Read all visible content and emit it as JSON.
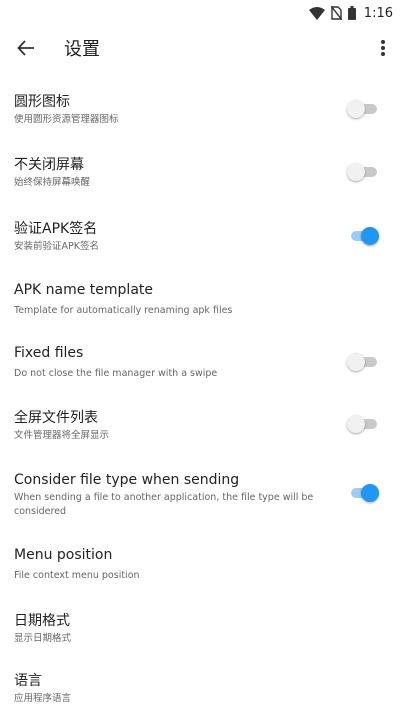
{
  "status_bar": {
    "time": "1:16",
    "icons": [
      "wifi-icon",
      "no-sim-icon",
      "battery-icon"
    ]
  },
  "app_bar": {
    "title": "设置",
    "back_icon": "arrow-back-icon",
    "menu_icon": "more-vert-icon"
  },
  "accent_color": "#2196f3",
  "settings": [
    {
      "title": "圆形图标",
      "summary": "使用圆形资源管理器图标",
      "toggle": "off"
    },
    {
      "title": "不关闭屏幕",
      "summary": "始终保持屏幕唤醒",
      "toggle": "off"
    },
    {
      "title": "验证APK签名",
      "summary": "安装前验证APK签名",
      "toggle": "on"
    },
    {
      "title": "APK name template",
      "summary": "Template for automatically renaming apk files"
    },
    {
      "title": "Fixed files",
      "summary": "Do not close the file manager with a swipe",
      "toggle": "off"
    },
    {
      "title": "全屏文件列表",
      "summary": "文件管理器将全屏显示",
      "toggle": "off"
    },
    {
      "title": "Consider file type when sending",
      "summary": "When sending a file to another application, the file type will be considered",
      "toggle": "on"
    },
    {
      "title": "Menu position",
      "summary": "File context menu position"
    },
    {
      "title": "日期格式",
      "summary": "显示日期格式"
    },
    {
      "title": "语言",
      "summary": "应用程序语言"
    }
  ]
}
